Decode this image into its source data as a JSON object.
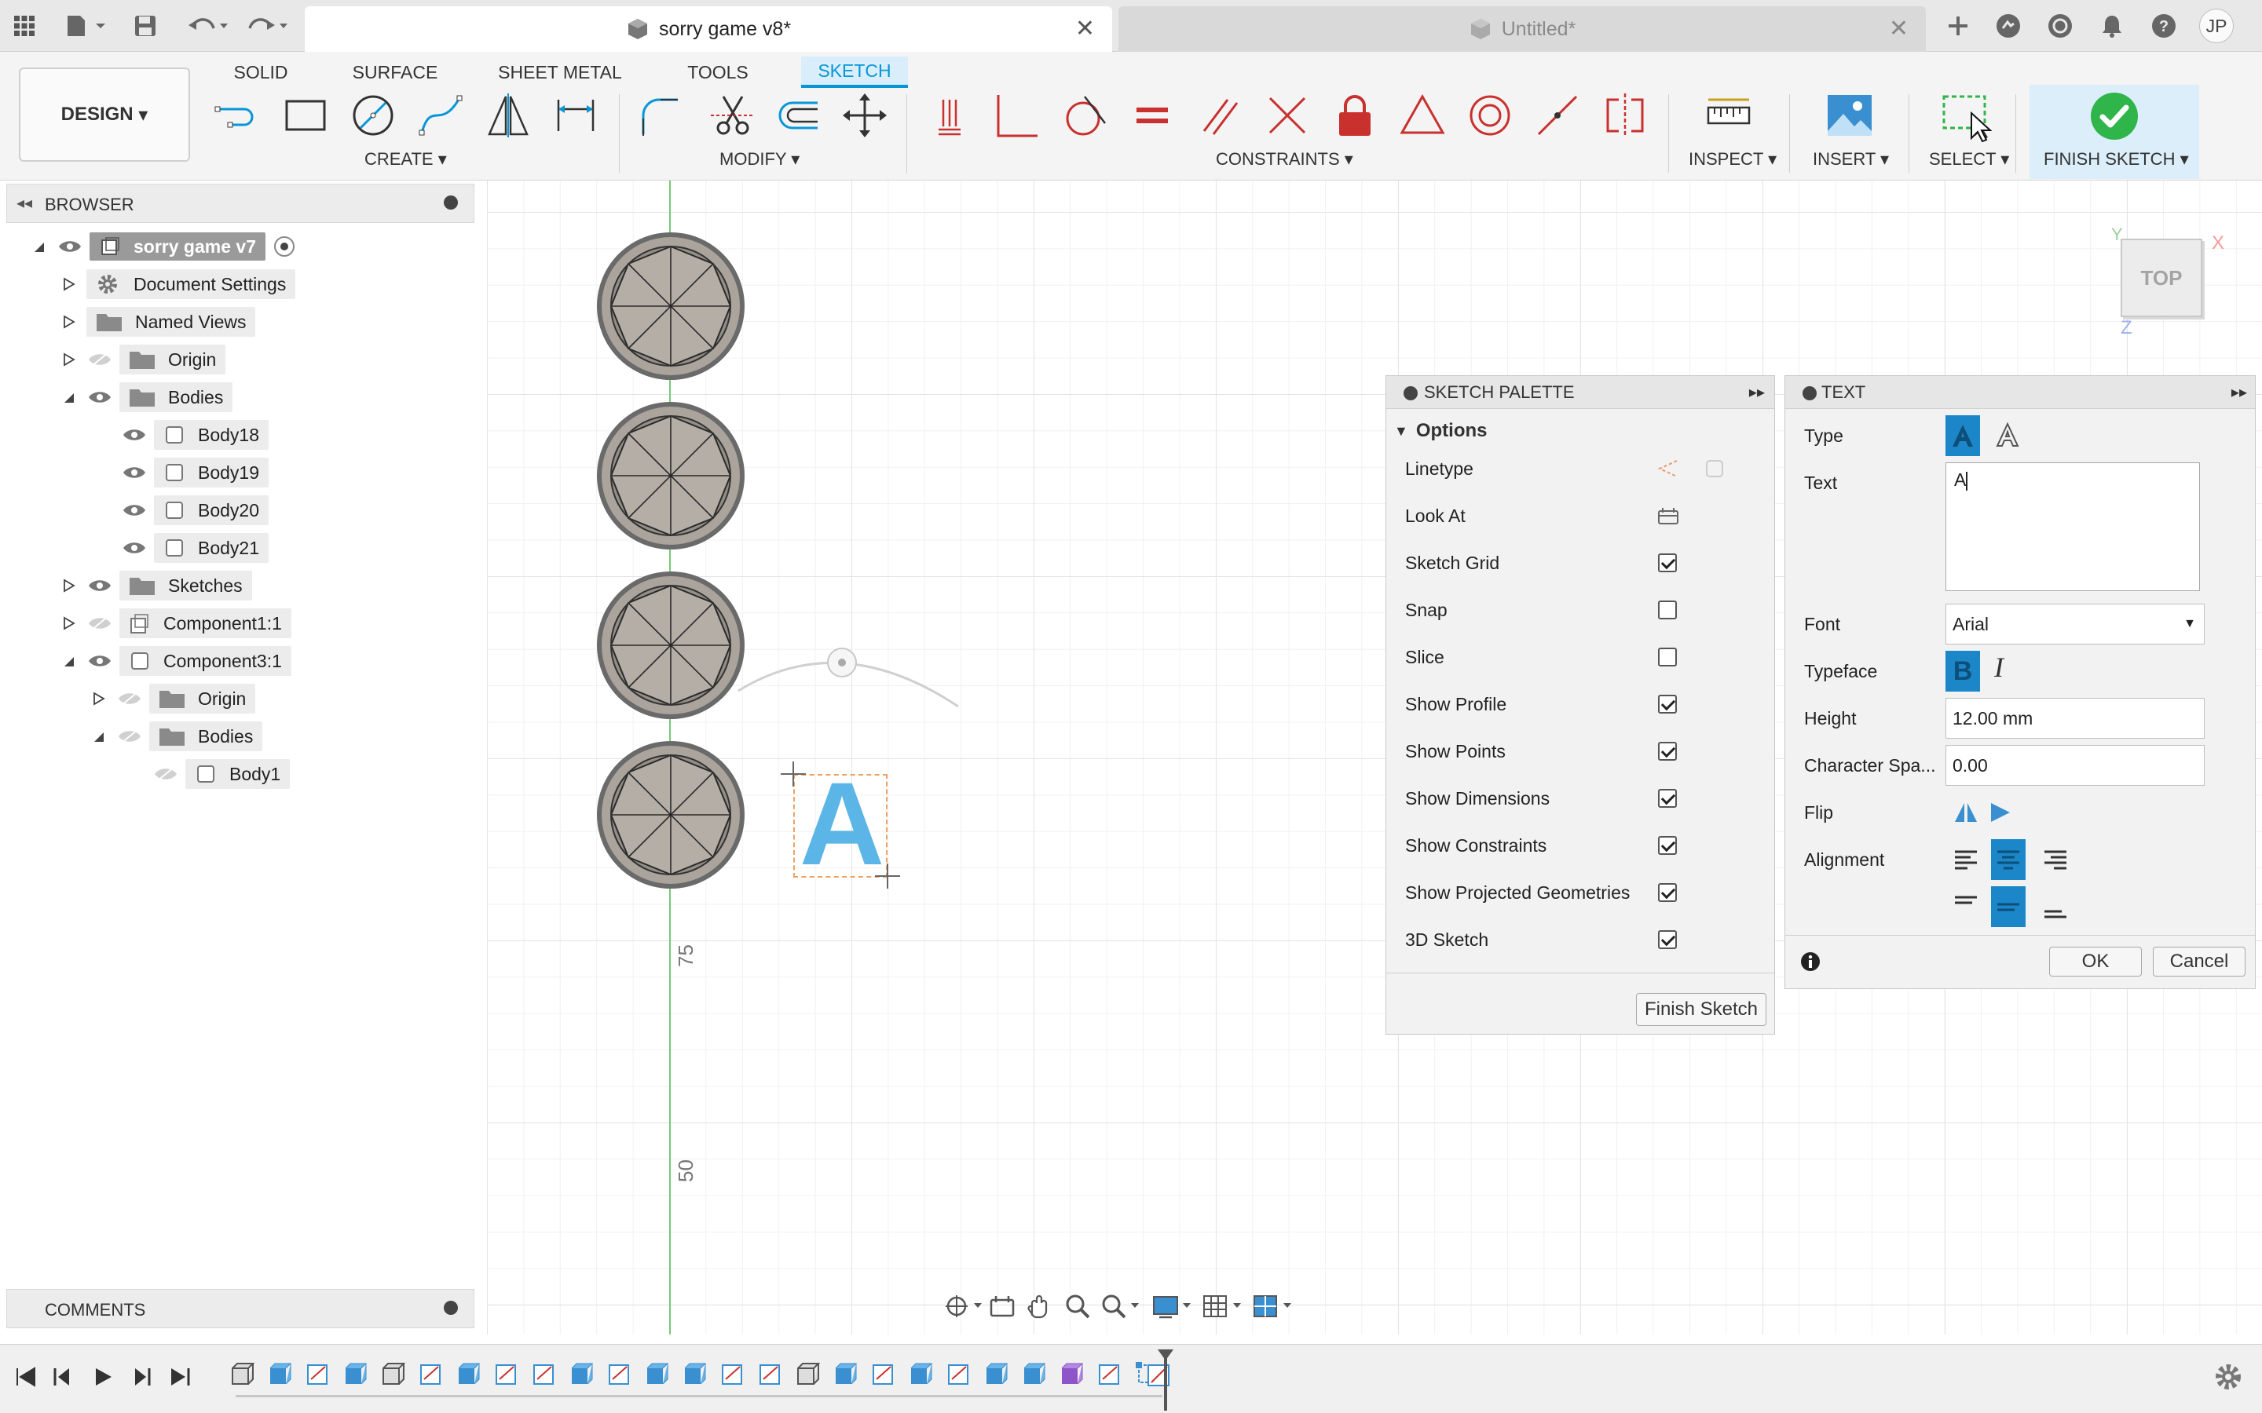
{
  "tabs": {
    "active_title": "sorry game v8*",
    "inactive_title": "Untitled*",
    "user_initials": "JP"
  },
  "ribbon": {
    "tabs": [
      "SOLID",
      "SURFACE",
      "SHEET METAL",
      "TOOLS",
      "SKETCH"
    ],
    "active_tab": "SKETCH",
    "workspace": "DESIGN",
    "groups": {
      "create": "CREATE",
      "modify": "MODIFY",
      "constraints": "CONSTRAINTS",
      "inspect": "INSPECT",
      "insert": "INSERT",
      "select": "SELECT",
      "finish": "FINISH SKETCH"
    }
  },
  "browser": {
    "title": "BROWSER",
    "items": [
      {
        "label": "sorry game v7",
        "level": 0,
        "expanded": true
      },
      {
        "label": "Document Settings",
        "level": 1,
        "expanded": false
      },
      {
        "label": "Named Views",
        "level": 1,
        "expanded": false
      },
      {
        "label": "Origin",
        "level": 1,
        "expanded": false
      },
      {
        "label": "Bodies",
        "level": 1,
        "expanded": true
      },
      {
        "label": "Body18",
        "level": 2
      },
      {
        "label": "Body19",
        "level": 2
      },
      {
        "label": "Body20",
        "level": 2
      },
      {
        "label": "Body21",
        "level": 2
      },
      {
        "label": "Sketches",
        "level": 1,
        "expanded": false
      },
      {
        "label": "Component1:1",
        "level": 1,
        "expanded": false
      },
      {
        "label": "Component3:1",
        "level": 1,
        "expanded": true
      },
      {
        "label": "Origin",
        "level": 2,
        "expanded": false
      },
      {
        "label": "Bodies",
        "level": 2,
        "expanded": true
      },
      {
        "label": "Body1",
        "level": 3
      }
    ]
  },
  "canvas": {
    "ruler_75": "75",
    "ruler_50": "50",
    "sketch_text": "A",
    "viewcube_label": "TOP",
    "axis_x": "X",
    "axis_y": "Y",
    "axis_z": "Z"
  },
  "sketch_palette": {
    "title": "SKETCH PALETTE",
    "section": "Options",
    "rows": [
      {
        "label": "Linetype"
      },
      {
        "label": "Look At"
      },
      {
        "label": "Sketch Grid",
        "checked": true
      },
      {
        "label": "Snap",
        "checked": false
      },
      {
        "label": "Slice",
        "checked": false
      },
      {
        "label": "Show Profile",
        "checked": true
      },
      {
        "label": "Show Points",
        "checked": true
      },
      {
        "label": "Show Dimensions",
        "checked": true
      },
      {
        "label": "Show Constraints",
        "checked": true
      },
      {
        "label": "Show Projected Geometries",
        "checked": true
      },
      {
        "label": "3D Sketch",
        "checked": true
      }
    ],
    "finish_button": "Finish Sketch"
  },
  "text_dialog": {
    "title": "TEXT",
    "type_label": "Type",
    "text_label": "Text",
    "text_value": "A",
    "font_label": "Font",
    "font_value": "Arial",
    "typeface_label": "Typeface",
    "height_label": "Height",
    "height_value": "12.00 mm",
    "spacing_label": "Character Spa...",
    "spacing_value": "0.00",
    "flip_label": "Flip",
    "alignment_label": "Alignment",
    "ok": "OK",
    "cancel": "Cancel"
  },
  "comments": {
    "title": "COMMENTS"
  },
  "colors": {
    "accent": "#0696d7",
    "sketch_red": "#c8312e",
    "text_blue": "#5bb5e6",
    "finish_green": "#2fb54a"
  }
}
